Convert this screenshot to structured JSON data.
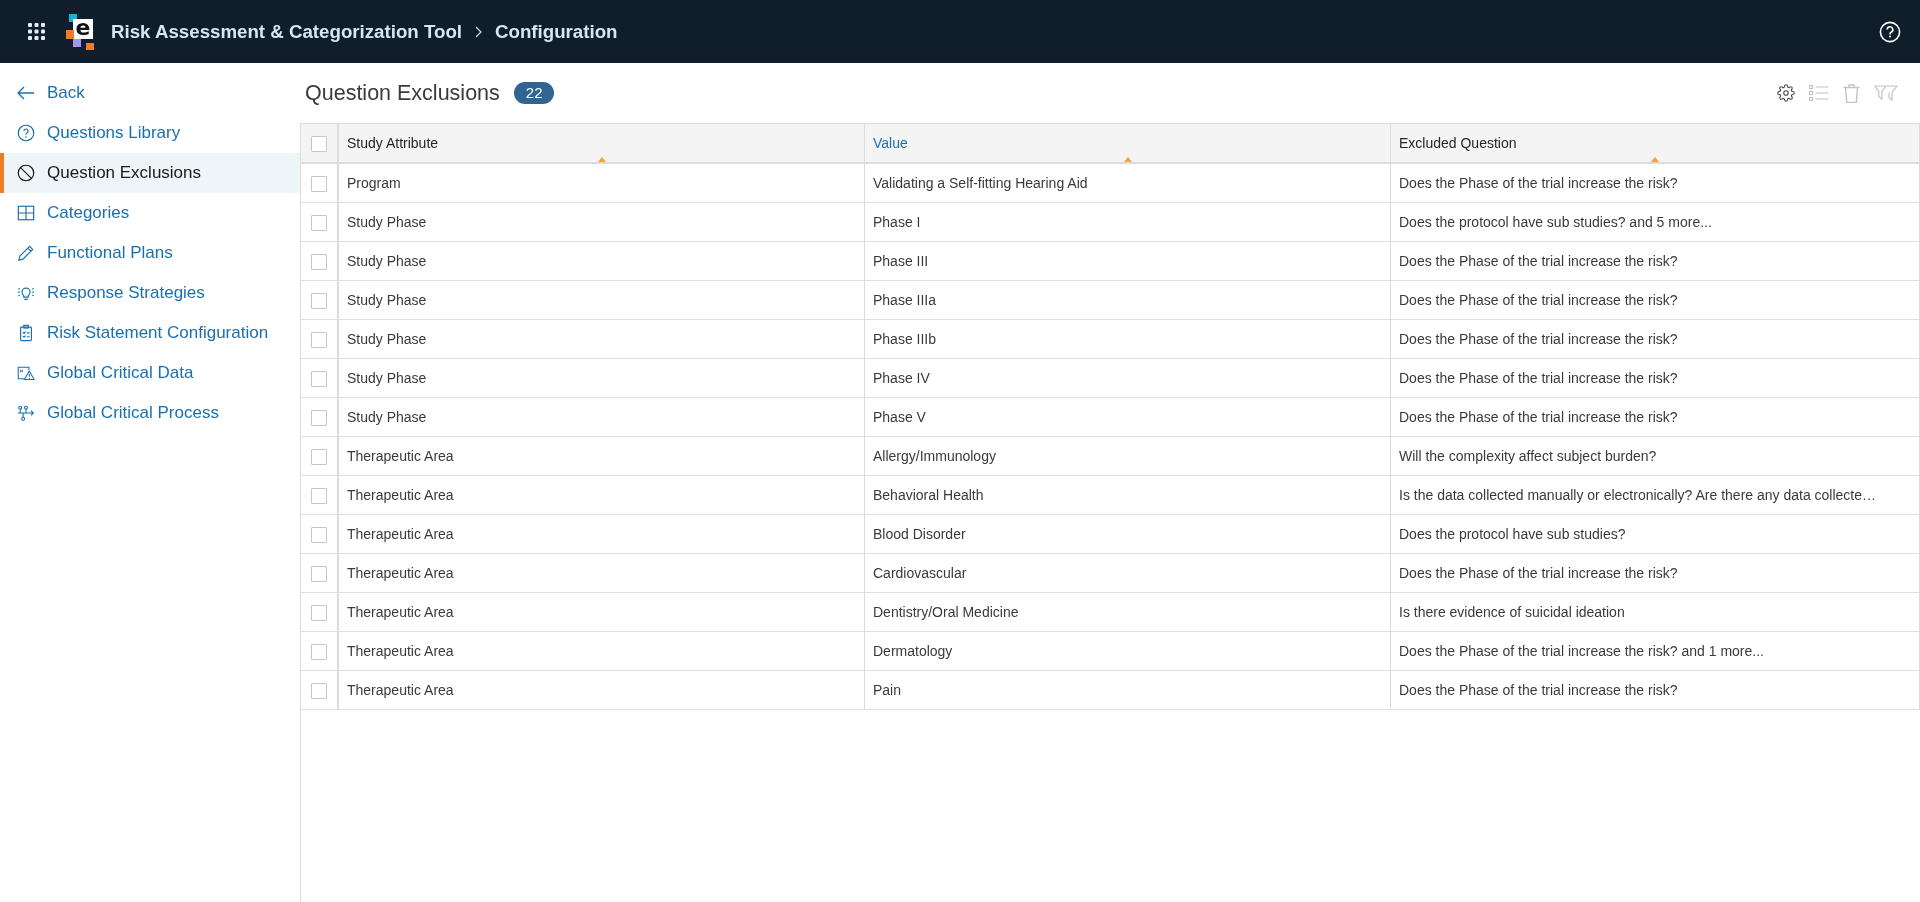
{
  "header": {
    "logo_letter": "e",
    "app_title": "Risk Assessment & Categorization Tool",
    "page_title": "Configuration"
  },
  "sidebar": {
    "back_link": "Back",
    "items": [
      {
        "label": "Questions Library",
        "selected": false
      },
      {
        "label": "Question Exclusions",
        "selected": true
      },
      {
        "label": "Categories",
        "selected": false
      },
      {
        "label": "Functional Plans",
        "selected": false
      },
      {
        "label": "Response Strategies",
        "selected": false
      },
      {
        "label": "Risk Statement Configuration",
        "selected": false
      },
      {
        "label": "Global Critical Data",
        "selected": false
      },
      {
        "label": "Global Critical Process",
        "selected": false
      }
    ]
  },
  "main": {
    "title": "Question Exclusions",
    "count": "22",
    "toolbar": [
      {
        "disabled": false
      },
      {
        "disabled": true
      },
      {
        "disabled": true
      },
      {
        "disabled": true
      }
    ]
  },
  "table": {
    "select_all_checked": false,
    "columns": [
      {
        "label": "Study Attribute",
        "highlighted": false,
        "sorted": true
      },
      {
        "label": "Value",
        "highlighted": true,
        "sorted": true
      },
      {
        "label": "Excluded Question",
        "highlighted": false,
        "sorted": true
      }
    ],
    "rows": [
      {
        "checked": false,
        "cells": [
          "Program",
          "Validating a Self-fitting Hearing Aid",
          "Does the Phase of the trial increase the risk?"
        ]
      },
      {
        "checked": false,
        "cells": [
          "Study Phase",
          "Phase I",
          "Does the protocol have sub studies? and 5 more..."
        ]
      },
      {
        "checked": false,
        "cells": [
          "Study Phase",
          "Phase III",
          "Does the Phase of the trial increase the risk?"
        ]
      },
      {
        "checked": false,
        "cells": [
          "Study Phase",
          "Phase IIIa",
          "Does the Phase of the trial increase the risk?"
        ]
      },
      {
        "checked": false,
        "cells": [
          "Study Phase",
          "Phase IIIb",
          "Does the Phase of the trial increase the risk?"
        ]
      },
      {
        "checked": false,
        "cells": [
          "Study Phase",
          "Phase IV",
          "Does the Phase of the trial increase the risk?"
        ]
      },
      {
        "checked": false,
        "cells": [
          "Study Phase",
          "Phase V",
          "Does the Phase of the trial increase the risk?"
        ]
      },
      {
        "checked": false,
        "cells": [
          "Therapeutic Area",
          "Allergy/Immunology",
          "Will the complexity affect subject burden?"
        ]
      },
      {
        "checked": false,
        "cells": [
          "Therapeutic Area",
          "Behavioral Health",
          "Is the data collected manually or electronically? Are there any data collecte…"
        ]
      },
      {
        "checked": false,
        "cells": [
          "Therapeutic Area",
          "Blood Disorder",
          "Does the protocol have sub studies?"
        ]
      },
      {
        "checked": false,
        "cells": [
          "Therapeutic Area",
          "Cardiovascular",
          "Does the Phase of the trial increase the risk?"
        ]
      },
      {
        "checked": false,
        "cells": [
          "Therapeutic Area",
          "Dentistry/Oral Medicine",
          "Is there evidence of suicidal ideation"
        ]
      },
      {
        "checked": false,
        "cells": [
          "Therapeutic Area",
          "Dermatology",
          "Does the Phase of the trial increase the risk? and 1 more..."
        ]
      },
      {
        "checked": false,
        "cells": [
          "Therapeutic Area",
          "Pain",
          "Does the Phase of the trial increase the risk?"
        ]
      }
    ]
  }
}
